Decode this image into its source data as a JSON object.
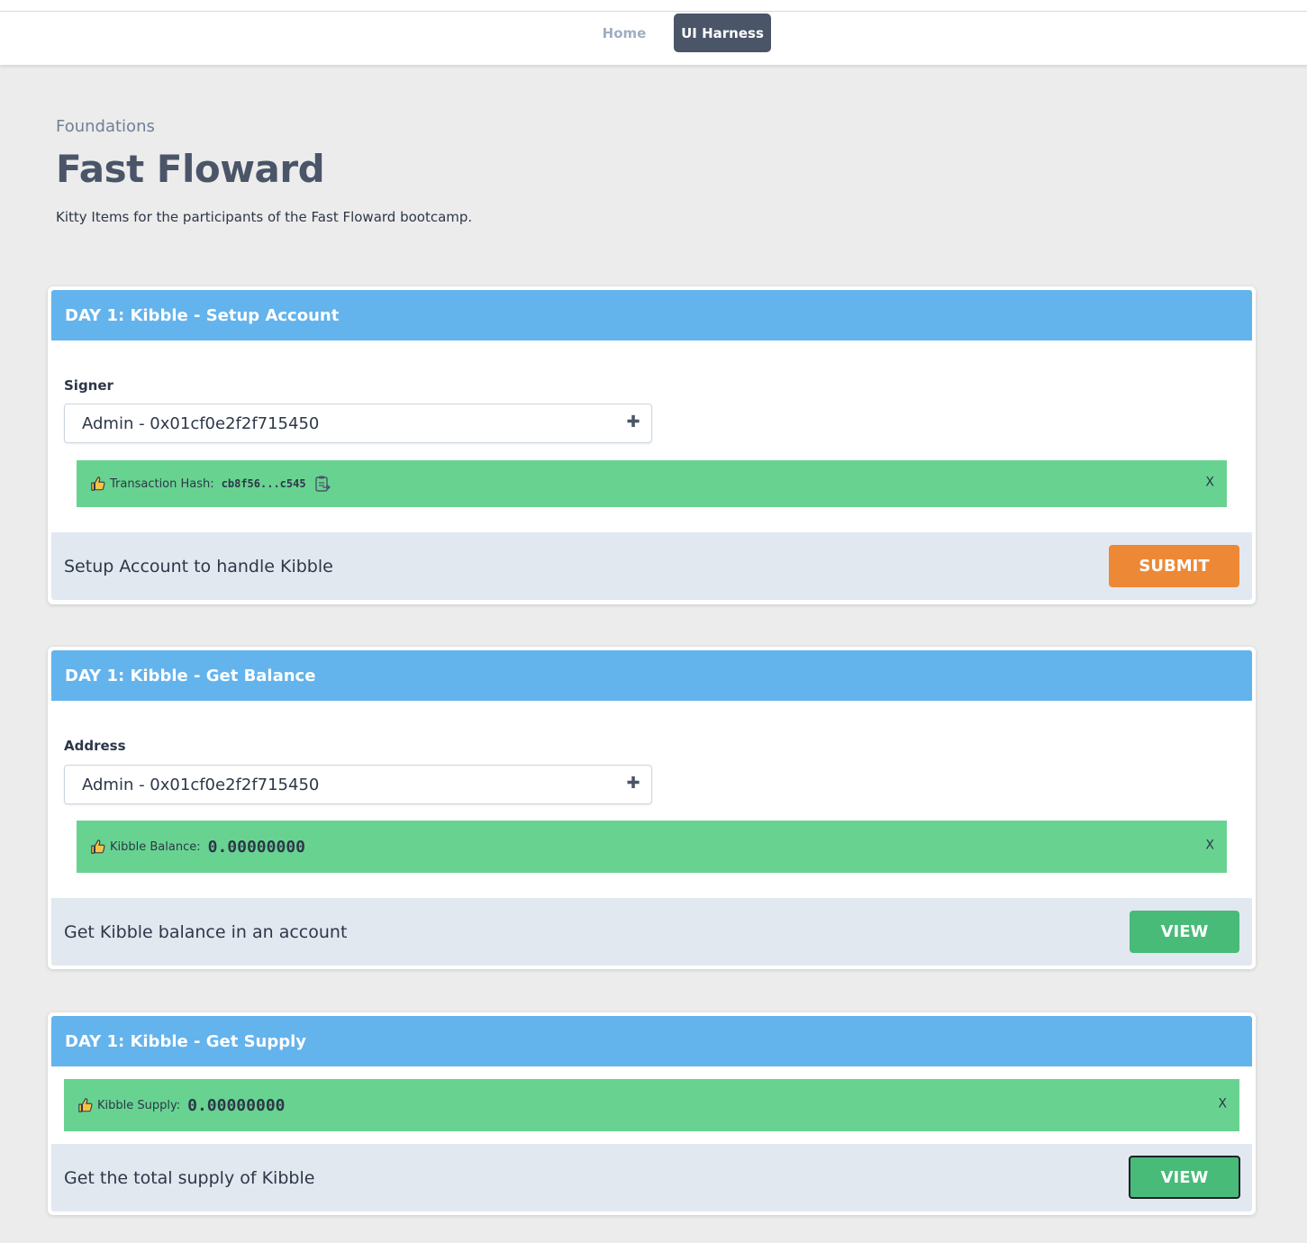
{
  "nav": {
    "home_label": "Home",
    "harness_label": "UI Harness"
  },
  "header": {
    "eyebrow": "Foundations",
    "title": "Fast Floward",
    "description": "Kitty Items for the participants of the Fast Floward bootcamp."
  },
  "cards": [
    {
      "title": "DAY 1: Kibble - Setup Account",
      "field_label": "Signer",
      "select_value": "Admin - 0x01cf0e2f2f715450",
      "alert_label": "Transaction Hash:",
      "alert_value": "cb8f56...c545",
      "alert_close": "X",
      "footer_text": "Setup Account to handle Kibble",
      "button_label": "SUBMIT"
    },
    {
      "title": "DAY 1: Kibble - Get Balance",
      "field_label": "Address",
      "select_value": "Admin - 0x01cf0e2f2f715450",
      "alert_label": "Kibble Balance:",
      "alert_value": "0.00000000",
      "alert_close": "X",
      "footer_text": "Get Kibble balance in an account",
      "button_label": "VIEW"
    },
    {
      "title": "DAY 1: Kibble - Get Supply",
      "alert_label": "Kibble Supply:",
      "alert_value": "0.00000000",
      "alert_close": "X",
      "footer_text": "Get the total supply of Kibble",
      "button_label": "VIEW"
    }
  ],
  "colors": {
    "header_blue": "#63b3ed",
    "alert_green": "#68d391",
    "submit_orange": "#ed8936",
    "view_green": "#48bb78",
    "nav_active": "#4a5568"
  }
}
